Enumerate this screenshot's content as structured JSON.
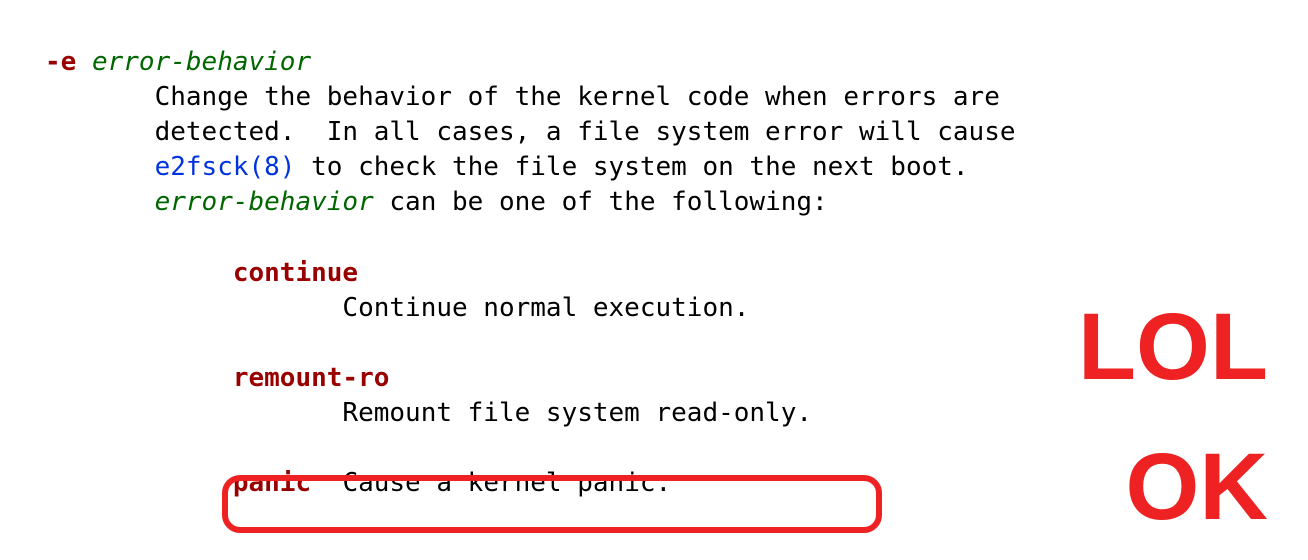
{
  "flag": "-e",
  "flag_arg": "error-behavior",
  "desc_line1a": "Change the behavior of the kernel code when errors are",
  "desc_line2a": "detected.  In all cases, a file system error will cause",
  "link_text": "e2fsck(8)",
  "desc_line3b": " to check the file system on the next boot.",
  "arg_repeat": "error-behavior",
  "desc_line4b": " can be one of the following:",
  "opts": {
    "continue": {
      "name": "continue",
      "desc": "Continue normal execution."
    },
    "remount": {
      "name": "remount-ro",
      "desc": "Remount file system read-only."
    },
    "panic": {
      "name": "panic",
      "desc": "Cause a kernel panic."
    }
  },
  "annot1": "LOL",
  "annot2": "OK"
}
